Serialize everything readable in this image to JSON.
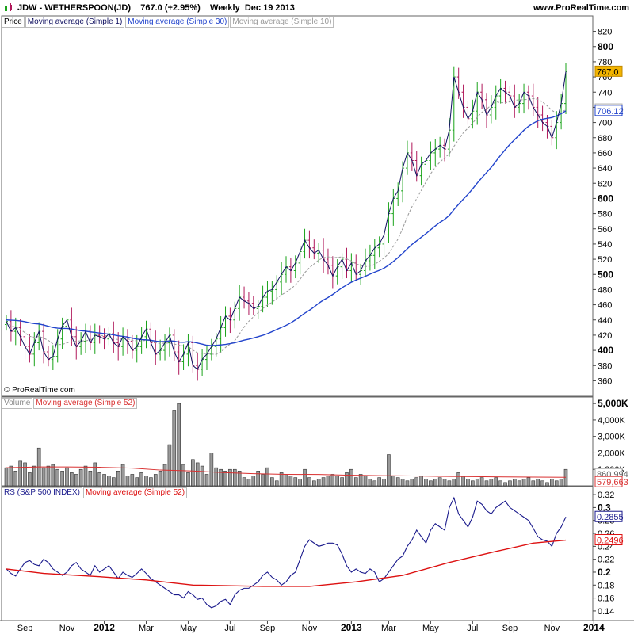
{
  "header": {
    "symbol_title": "JDW - WETHERSPOON(JD)",
    "last_price": "767.0",
    "change": "(+2.95%)",
    "period": "Weekly",
    "date": "Dec 19 2013",
    "site": "www.ProRealTime.com"
  },
  "copyright": "© ProRealTime.com",
  "colors": {
    "up": "#1aa31a",
    "down": "#b0185a",
    "ma1": "#101060",
    "ma30": "#2244cc",
    "ma10": "#999999",
    "vol_ma": "#d93030",
    "rs": "#1a1a8c",
    "rs_ma": "#dd1111",
    "price_badge": "#f2b400"
  },
  "chart_data": [
    {
      "type": "candlestick",
      "panel": "price",
      "legend": [
        "Price",
        "Moving average (Simple 1)",
        "Moving average (Simple 30)",
        "Moving average (Simple 10)"
      ],
      "ylim": [
        350,
        830
      ],
      "yticks": [
        360,
        380,
        400,
        420,
        440,
        460,
        480,
        500,
        520,
        540,
        560,
        580,
        600,
        620,
        640,
        660,
        680,
        700,
        720,
        740,
        760,
        780,
        800,
        820
      ],
      "bold_ticks": [
        400,
        500,
        600,
        800
      ],
      "x_months": [
        "Sep",
        "Nov",
        "2012",
        "Mar",
        "May",
        "Jul",
        "Sep",
        "Nov",
        "2013",
        "Mar",
        "May",
        "Jul",
        "Sep",
        "Nov",
        "2014"
      ],
      "x_month_week": [
        4,
        13,
        21,
        30,
        39,
        48,
        56,
        65,
        74,
        82,
        91,
        100,
        108,
        117,
        126
      ],
      "close_series": [
        438,
        425,
        430,
        418,
        405,
        395,
        410,
        425,
        398,
        388,
        392,
        415,
        432,
        440,
        418,
        405,
        412,
        425,
        410,
        420,
        418,
        415,
        422,
        410,
        405,
        418,
        412,
        400,
        405,
        418,
        428,
        410,
        395,
        400,
        410,
        420,
        398,
        385,
        395,
        410,
        380,
        375,
        388,
        395,
        405,
        415,
        430,
        445,
        440,
        455,
        470,
        465,
        462,
        455,
        458,
        470,
        478,
        480,
        490,
        500,
        510,
        505,
        515,
        530,
        545,
        535,
        528,
        532,
        520,
        512,
        498,
        510,
        520,
        505,
        515,
        500,
        505,
        518,
        525,
        535,
        540,
        552,
        580,
        600,
        610,
        640,
        660,
        650,
        630,
        645,
        650,
        660,
        665,
        670,
        665,
        690,
        760,
        740,
        720,
        705,
        715,
        740,
        730,
        710,
        720,
        735,
        745,
        740,
        735,
        720,
        725,
        740,
        735,
        720,
        710,
        700,
        695,
        680,
        700,
        725,
        767
      ],
      "ma30_start_value": 440,
      "last_values": {
        "close": "767.0",
        "ma10": "720.60",
        "ma30": "706.12"
      }
    },
    {
      "type": "bar",
      "panel": "volume",
      "legend": [
        "Volume",
        "Moving average (Simple 52)"
      ],
      "ylim": [
        0,
        5200
      ],
      "yticks": [
        "1,000K",
        "2,000K",
        "3,000K",
        "4,000K",
        "5,000K"
      ],
      "ytick_values": [
        1000,
        2000,
        3000,
        4000,
        5000
      ],
      "values": [
        1100,
        1200,
        900,
        1500,
        1400,
        800,
        1200,
        2300,
        1100,
        1200,
        1300,
        1000,
        900,
        1100,
        800,
        700,
        1000,
        1200,
        900,
        1400,
        800,
        700,
        600,
        500,
        900,
        1300,
        600,
        700,
        500,
        800,
        600,
        500,
        700,
        900,
        1300,
        2500,
        4600,
        5000,
        1300,
        800,
        1600,
        1400,
        1200,
        700,
        2000,
        1100,
        1000,
        900,
        1000,
        1000,
        900,
        500,
        400,
        600,
        900,
        700,
        1100,
        500,
        300,
        800,
        700,
        600,
        500,
        400,
        1000,
        500,
        300,
        400,
        500,
        600,
        700,
        600,
        500,
        800,
        1000,
        500,
        700,
        600,
        400,
        300,
        500,
        400,
        1900,
        600,
        500,
        400,
        300,
        400,
        500,
        600,
        400,
        300,
        400,
        500,
        400,
        300,
        400,
        800,
        600,
        400,
        300,
        400,
        500,
        300,
        400,
        500,
        300,
        200,
        300,
        400,
        300,
        400,
        500,
        300,
        400,
        300,
        200,
        400,
        300,
        400,
        1000
      ],
      "ma52": [
        1100,
        1150,
        1150,
        1130,
        1080,
        960,
        900,
        800,
        740,
        700,
        690,
        650,
        620,
        600,
        580,
        560,
        540,
        530,
        520
      ],
      "last_values": {
        "volume": "860,994",
        "ma52": "579,663"
      }
    },
    {
      "type": "line",
      "panel": "rs",
      "legend": [
        "RS (S&P 500 INDEX)",
        "Moving average (Simple 52)"
      ],
      "ylim": [
        0.135,
        0.325
      ],
      "yticks": [
        0.14,
        0.16,
        0.18,
        0.2,
        0.22,
        0.24,
        0.26,
        0.28,
        0.3,
        0.32
      ],
      "ytick_labels": [
        "0.14",
        "0.16",
        "0.18",
        "0.2",
        "0.22",
        "0.24",
        "0.26",
        "0.28",
        "0.3",
        "0.32"
      ],
      "bold_ticks": [
        0.2,
        0.3
      ],
      "values": [
        0.205,
        0.198,
        0.194,
        0.205,
        0.215,
        0.218,
        0.212,
        0.21,
        0.22,
        0.215,
        0.205,
        0.2,
        0.195,
        0.2,
        0.21,
        0.215,
        0.205,
        0.2,
        0.195,
        0.21,
        0.2,
        0.205,
        0.21,
        0.2,
        0.19,
        0.2,
        0.195,
        0.192,
        0.198,
        0.205,
        0.198,
        0.19,
        0.185,
        0.18,
        0.175,
        0.17,
        0.165,
        0.165,
        0.16,
        0.17,
        0.165,
        0.158,
        0.16,
        0.15,
        0.145,
        0.148,
        0.155,
        0.158,
        0.15,
        0.165,
        0.172,
        0.175,
        0.175,
        0.18,
        0.185,
        0.195,
        0.2,
        0.192,
        0.188,
        0.18,
        0.185,
        0.195,
        0.2,
        0.22,
        0.24,
        0.25,
        0.245,
        0.24,
        0.242,
        0.245,
        0.245,
        0.242,
        0.228,
        0.21,
        0.2,
        0.205,
        0.2,
        0.198,
        0.205,
        0.2,
        0.185,
        0.19,
        0.2,
        0.21,
        0.22,
        0.225,
        0.24,
        0.25,
        0.265,
        0.255,
        0.245,
        0.265,
        0.275,
        0.27,
        0.265,
        0.3,
        0.315,
        0.29,
        0.28,
        0.27,
        0.285,
        0.31,
        0.305,
        0.295,
        0.29,
        0.3,
        0.305,
        0.31,
        0.3,
        0.295,
        0.29,
        0.285,
        0.28,
        0.268,
        0.255,
        0.25,
        0.248,
        0.24,
        0.26,
        0.27,
        0.2855
      ],
      "ma52_start": 0.205,
      "ma52_points": [
        [
          0,
          0.205
        ],
        [
          8,
          0.198
        ],
        [
          20,
          0.193
        ],
        [
          30,
          0.188
        ],
        [
          40,
          0.18
        ],
        [
          55,
          0.178
        ],
        [
          65,
          0.178
        ],
        [
          75,
          0.185
        ],
        [
          85,
          0.195
        ],
        [
          95,
          0.215
        ],
        [
          105,
          0.232
        ],
        [
          113,
          0.245
        ],
        [
          120,
          0.2496
        ]
      ],
      "last_values": {
        "rs": "0.2855",
        "ma52": "0.2496"
      }
    }
  ]
}
